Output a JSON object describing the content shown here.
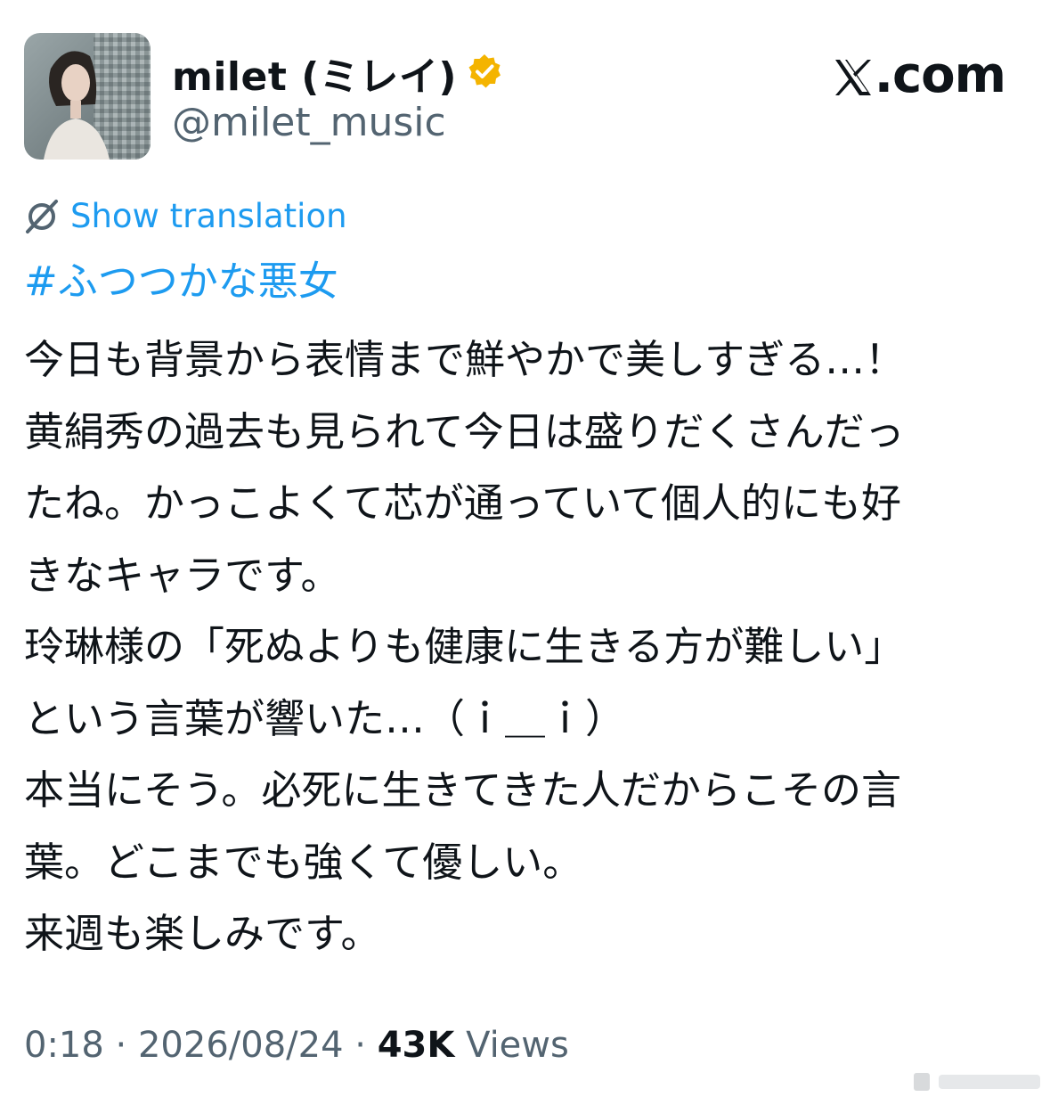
{
  "author": {
    "display_name": "milet (ミレイ)",
    "handle": "@milet_music",
    "verified_badge_icon": "verified-badge-icon",
    "badge_color": "#f4b400"
  },
  "site_label": "X.com",
  "translate": {
    "label": "Show translation",
    "icon": "translate-icon"
  },
  "hashtag": "#ふつつかな悪女",
  "body_lines": [
    "今日も背景から表情まで鮮やかで美しすぎる…！",
    "黄絹秀の過去も見られて今日は盛りだくさんだっ",
    "たね。かっこよくて芯が通っていて個人的にも好",
    "きなキャラです。",
    "玲琳様の「死ぬよりも健康に生きる方が難しい」",
    "という言葉が響いた…（ｉ＿ｉ）",
    "本当にそう。必死に生きてきた人だからこその言",
    "葉。どこまでも強くて優しい。",
    "来週も楽しみです。"
  ],
  "meta": {
    "time": "0:18",
    "date": "2026/08/24",
    "views_count": "43K",
    "views_label": "Views",
    "separator": "·"
  },
  "colors": {
    "link": "#1d9bf0",
    "muted": "#536471",
    "text": "#0f1419"
  }
}
